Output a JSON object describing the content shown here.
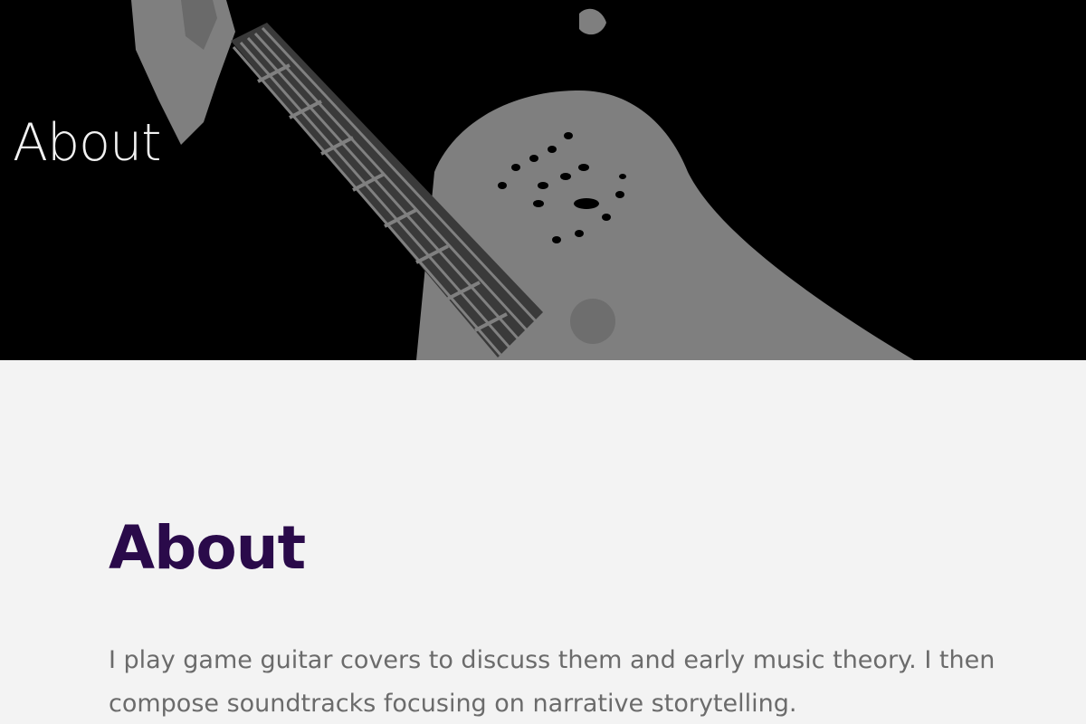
{
  "hero": {
    "title": "About",
    "image": "guitar-photo"
  },
  "main": {
    "heading": "About",
    "body": "I play game guitar covers to discuss them and early music theory. I then compose soundtracks focusing on narrative storytelling."
  },
  "colors": {
    "hero_background": "#000000",
    "page_background": "#f3f3f3",
    "heading": "#2a0a4a",
    "body_text": "#6b6b6b",
    "hero_title": "#f2f2f2"
  }
}
